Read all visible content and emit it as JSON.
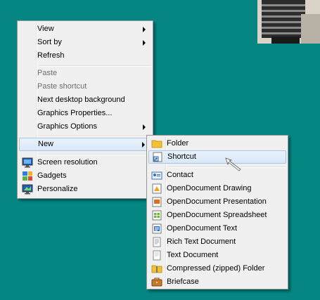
{
  "context_menu": {
    "items": [
      {
        "label": "View"
      },
      {
        "label": "Sort by"
      },
      {
        "label": "Refresh"
      },
      {
        "label": "Paste"
      },
      {
        "label": "Paste shortcut"
      },
      {
        "label": "Next desktop background"
      },
      {
        "label": "Graphics Properties..."
      },
      {
        "label": "Graphics Options"
      },
      {
        "label": "New"
      },
      {
        "label": "Screen resolution"
      },
      {
        "label": "Gadgets"
      },
      {
        "label": "Personalize"
      }
    ]
  },
  "new_submenu": {
    "items": [
      {
        "label": "Folder"
      },
      {
        "label": "Shortcut"
      },
      {
        "label": "Contact"
      },
      {
        "label": "OpenDocument Drawing"
      },
      {
        "label": "OpenDocument Presentation"
      },
      {
        "label": "OpenDocument Spreadsheet"
      },
      {
        "label": "OpenDocument Text"
      },
      {
        "label": "Rich Text Document"
      },
      {
        "label": "Text Document"
      },
      {
        "label": "Compressed (zipped) Folder"
      },
      {
        "label": "Briefcase"
      }
    ]
  },
  "colors": {
    "desktop": "#058683",
    "menu_bg": "#f0f0f0",
    "highlight": "#d9e8f8"
  }
}
